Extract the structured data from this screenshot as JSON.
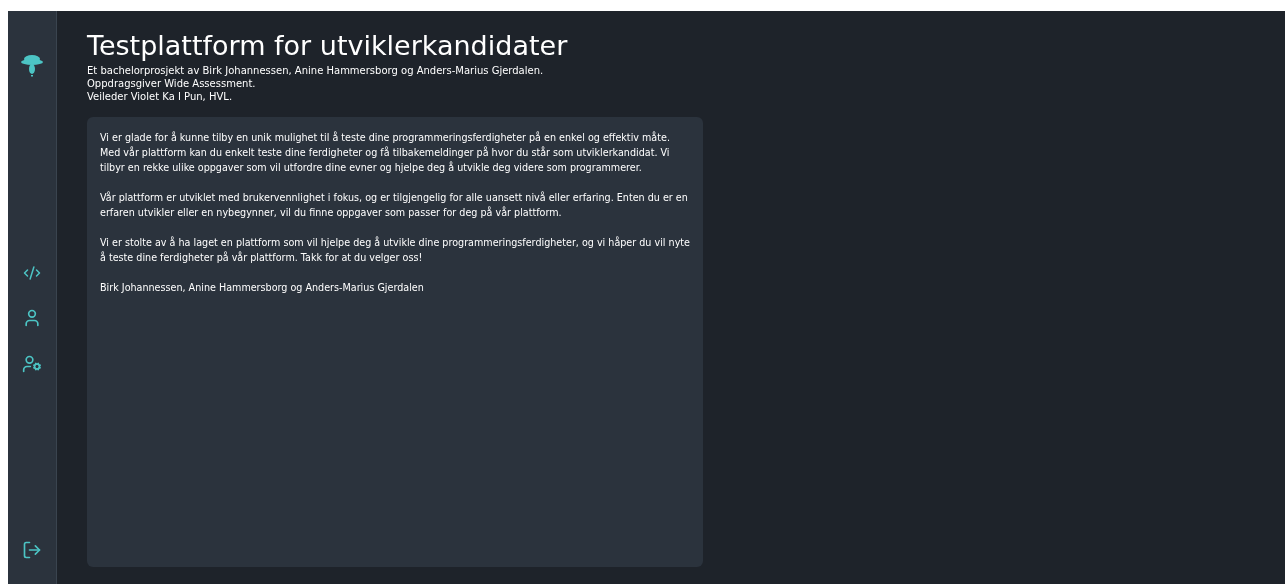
{
  "header": {
    "title": "Testplattform for utviklerkandidater",
    "lines": [
      "Et bachelorprosjekt av Birk Johannessen, Anine Hammersborg og Anders-Marius Gjerdalen.",
      "Oppdragsgiver Wide Assessment.",
      "Veileder Violet Ka I Pun, HVL."
    ]
  },
  "card": {
    "paragraphs": [
      "Vi er glade for å kunne tilby en unik mulighet til å teste dine programmeringsferdigheter på en enkel og effektiv måte. Med vår plattform kan du enkelt teste dine ferdigheter og få tilbakemeldinger på hvor du står som utviklerkandidat. Vi tilbyr en rekke ulike oppgaver som vil utfordre dine evner og hjelpe deg å utvikle deg videre som programmerer.",
      "Vår plattform er utviklet med brukervennlighet i fokus, og er tilgjengelig for alle uansett nivå eller erfaring. Enten du er en erfaren utvikler eller en nybegynner, vil du finne oppgaver som passer for deg på vår plattform.",
      "Vi er stolte av å ha laget en plattform som vil hjelpe deg å utvikle dine programmeringsferdigheter, og vi håper du vil nyte å teste dine ferdigheter på vår plattform. Takk for at du velger oss!",
      "Birk Johannessen, Anine Hammersborg og Anders-Marius Gjerdalen"
    ]
  }
}
